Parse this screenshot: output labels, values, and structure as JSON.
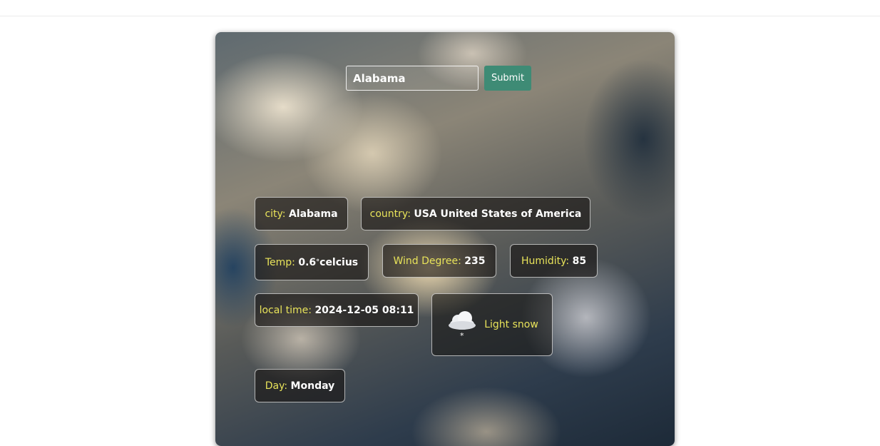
{
  "search": {
    "value": "Alabama",
    "submit_label": "Submit"
  },
  "weather": {
    "city": {
      "label": "city:",
      "value": "Alabama"
    },
    "country": {
      "label": "country:",
      "value": "USA United States of America"
    },
    "temp": {
      "label": "Temp:",
      "value": "0.6",
      "degree": "°",
      "unit": "celcius"
    },
    "wind": {
      "label": "Wind Degree:",
      "value": "235"
    },
    "humidity": {
      "label": "Humidity:",
      "value": "85"
    },
    "local_time": {
      "label": "local time:",
      "value": "2024-12-05 08:11"
    },
    "condition": {
      "text": "Light snow",
      "icon": "light-snow-icon"
    },
    "day": {
      "label": "Day:",
      "value": "Monday"
    }
  },
  "colors": {
    "label": "#e8e35a",
    "value": "#ffffff",
    "submit": "#3e8b75"
  }
}
